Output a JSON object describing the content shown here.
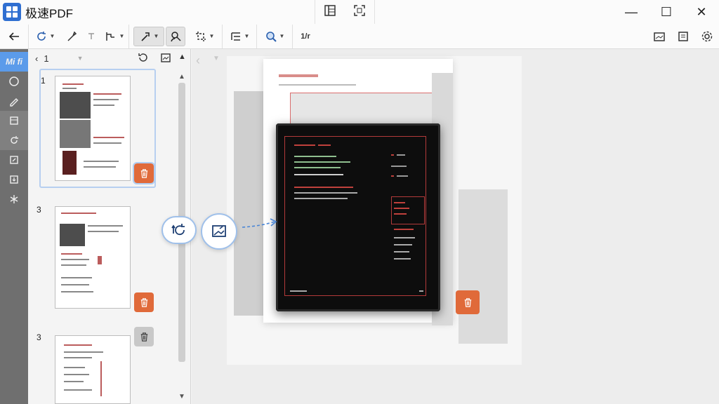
{
  "app": {
    "title": "极速PDF"
  },
  "window": {
    "minimize": "—",
    "maximize": "☐",
    "close": "✕"
  },
  "toolbar": {
    "page_jump_label": "1/r"
  },
  "rail": {
    "selected_label": "Mi fi"
  },
  "thumbs": {
    "current_page": "1",
    "page_labels": [
      "1",
      "3",
      "3"
    ]
  },
  "colors": {
    "accent": "#5b9bea",
    "trash": "#e06a3a",
    "rail": "#6f6f6f"
  },
  "icons": [
    "grid-logo-icon",
    "back-arrow-icon",
    "rotate-icon",
    "brush-icon",
    "crop-icon",
    "zoom-icon",
    "settings-icon",
    "trash-icon",
    "rotate-page-icon",
    "extract-image-icon"
  ]
}
